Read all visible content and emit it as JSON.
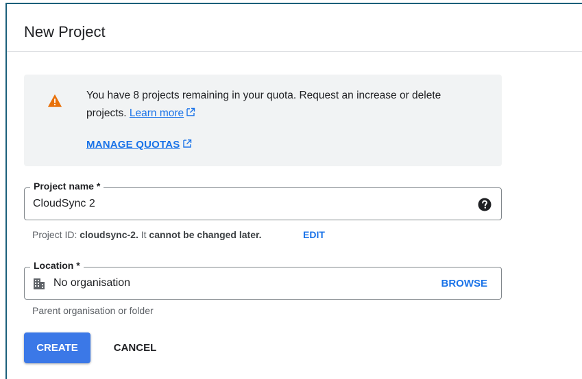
{
  "dialog": {
    "title": "New Project"
  },
  "quota": {
    "message_part1": "You have 8 projects remaining in your quota. Request an increase or delete projects.",
    "learn_more": "Learn more",
    "manage_quotas": "MANAGE QUOTAS",
    "icon": "warning-icon"
  },
  "project_name": {
    "label": "Project name *",
    "value": "CloudSync 2",
    "help_icon": "help-icon"
  },
  "project_id": {
    "prefix": "Project ID: ",
    "id": "cloudsync-2.",
    "middle": " It ",
    "emphasis": "cannot be changed later.",
    "edit_label": "EDIT"
  },
  "location": {
    "label": "Location *",
    "value": "No organisation",
    "browse_label": "BROWSE",
    "hint": "Parent organisation or folder",
    "icon": "organisation-icon"
  },
  "actions": {
    "create_label": "CREATE",
    "cancel_label": "CANCEL"
  },
  "colors": {
    "accent": "#1a73e8",
    "primary_button": "#3b78e7",
    "warning": "#e8710a",
    "frame_border": "#1a5f7a"
  }
}
